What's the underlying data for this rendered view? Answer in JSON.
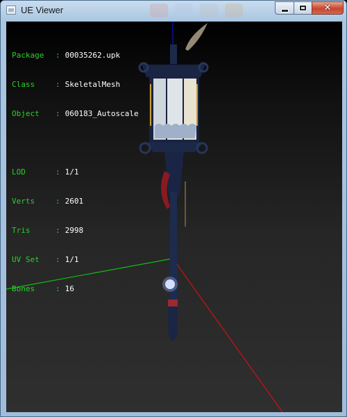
{
  "window": {
    "title": "UE Viewer"
  },
  "titlebar_buttons": {
    "minimize": "minimize-icon",
    "maximize": "maximize-icon",
    "close": "close-icon"
  },
  "info": {
    "group1": [
      {
        "key": "Package",
        "sep": ":",
        "value": "00035262.upk"
      },
      {
        "key": "Class",
        "sep": ":",
        "value": "SkeletalMesh"
      },
      {
        "key": "Object",
        "sep": ":",
        "value": "060183_Autoscale"
      }
    ],
    "group2": [
      {
        "key": "LOD",
        "sep": ":",
        "value": "1/1"
      },
      {
        "key": "Verts",
        "sep": ":",
        "value": "2601"
      },
      {
        "key": "Tris",
        "sep": ":",
        "value": "2998"
      },
      {
        "key": "UV Set",
        "sep": ":",
        "value": "1/1"
      },
      {
        "key": "Bones",
        "sep": ":",
        "value": "16"
      }
    ]
  },
  "colors": {
    "label": "#2ad12a",
    "value": "#ffffff",
    "axis_x": "#d01010",
    "axis_y": "#10c010",
    "axis_z": "#1010d0"
  }
}
